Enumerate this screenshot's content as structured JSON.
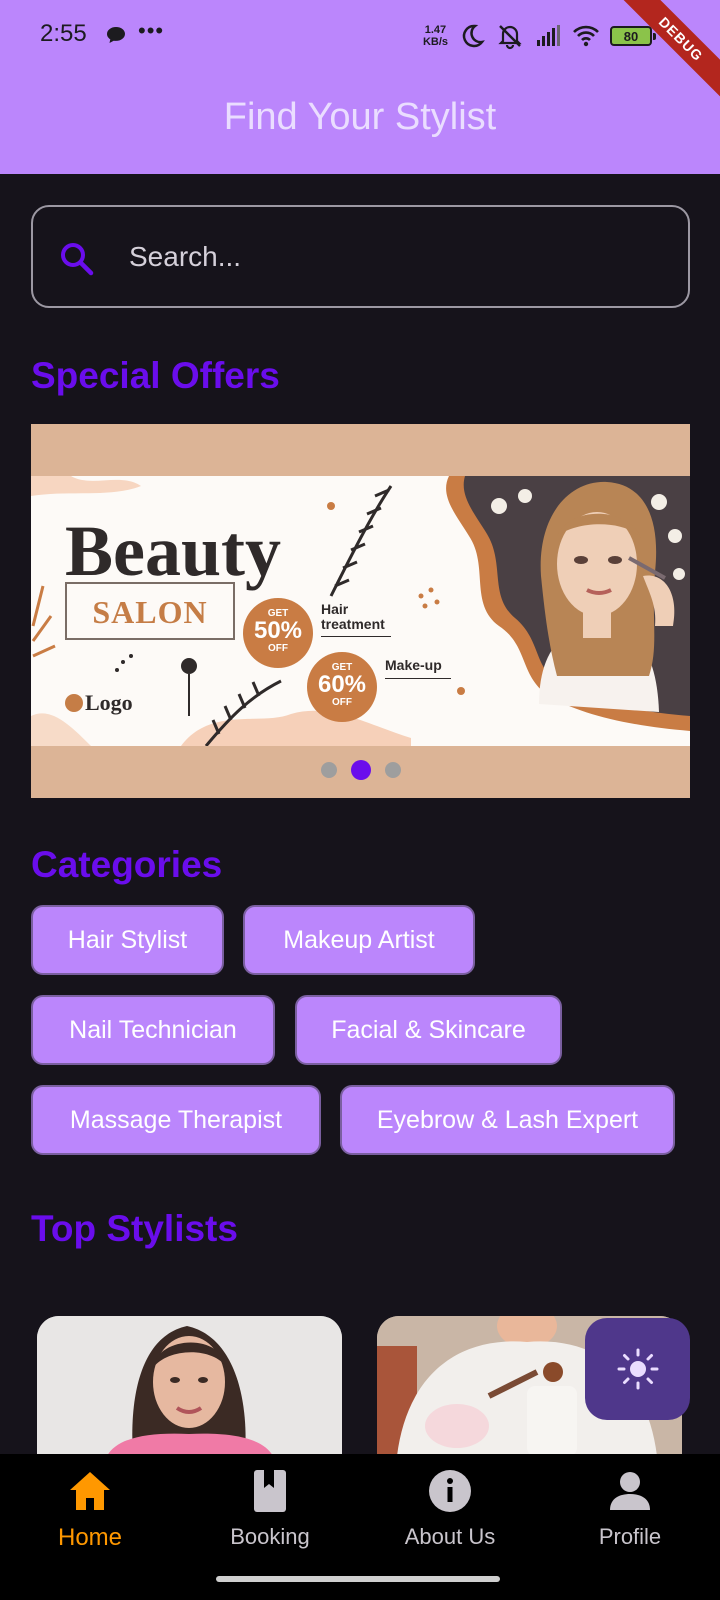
{
  "status_bar": {
    "time": "2:55",
    "net_speed_value": "1.47",
    "net_speed_unit": "KB/s",
    "battery": "80",
    "debug_label": "DEBUG"
  },
  "app_bar": {
    "title": "Find Your Stylist"
  },
  "search": {
    "placeholder": "Search..."
  },
  "special_offers": {
    "title": "Special Offers",
    "banner": {
      "headline": "Beauty",
      "subhead": "SALON",
      "logo_text": "Logo",
      "offers": [
        {
          "get": "GET",
          "percent": "50%",
          "off": "OFF",
          "service_line1": "Hair",
          "service_line2": "treatment"
        },
        {
          "get": "GET",
          "percent": "60%",
          "off": "OFF",
          "service_line1": "Make-up",
          "service_line2": ""
        }
      ]
    },
    "carousel": {
      "count": 3,
      "active_index": 1
    }
  },
  "categories": {
    "title": "Categories",
    "items": [
      "Hair Stylist",
      "Makeup Artist",
      "Nail Technician",
      "Facial & Skincare",
      "Massage Therapist",
      "Eyebrow & Lash Expert"
    ]
  },
  "top_stylists": {
    "title": "Top Stylists"
  },
  "bottom_nav": {
    "items": [
      {
        "label": "Home",
        "icon": "home-icon",
        "active": true
      },
      {
        "label": "Booking",
        "icon": "book-icon",
        "active": false
      },
      {
        "label": "About Us",
        "icon": "info-icon",
        "active": false
      },
      {
        "label": "Profile",
        "icon": "person-icon",
        "active": false
      }
    ]
  },
  "colors": {
    "app_bar": "#bb86fc",
    "background": "#16131b",
    "section_title": "#6a0dec",
    "chip": "#bb86fc",
    "nav_active": "#ff9800",
    "fab": "#4f378b"
  }
}
